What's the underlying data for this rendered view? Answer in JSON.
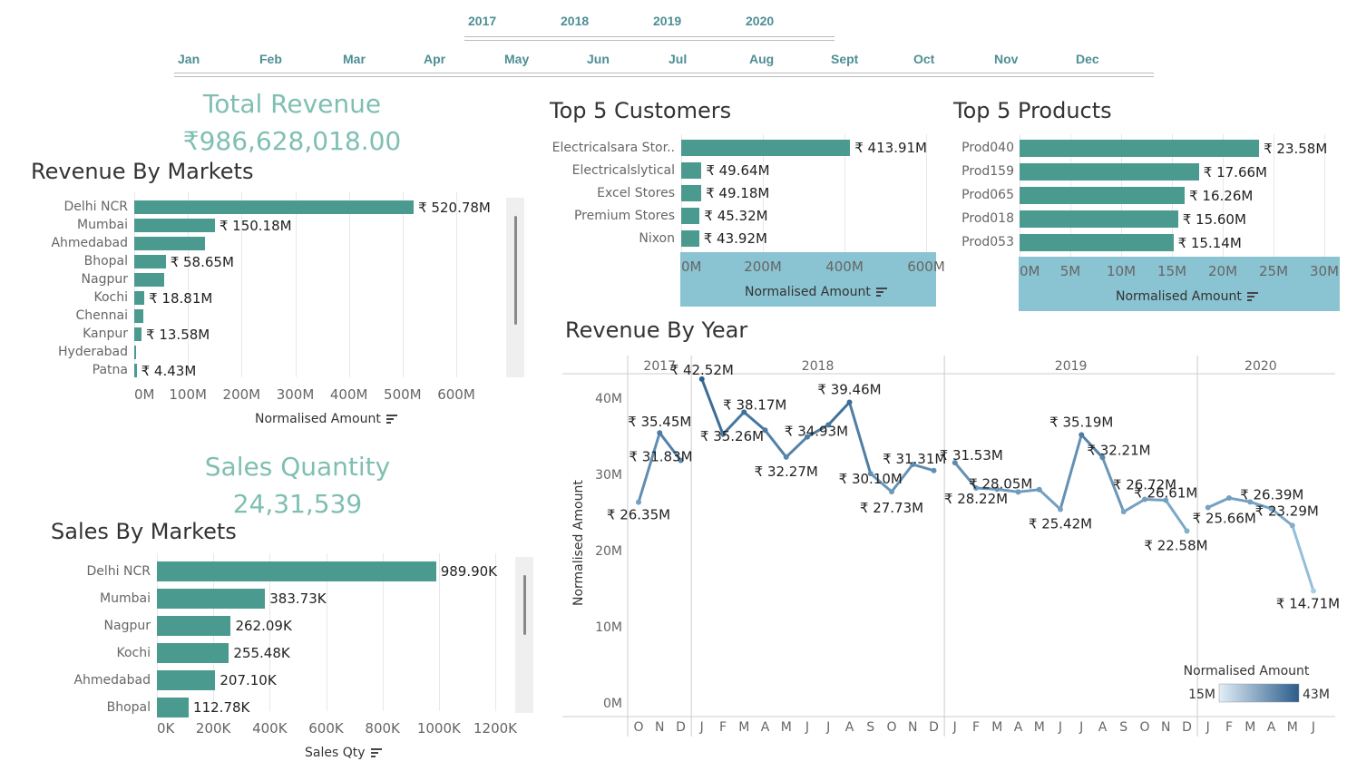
{
  "filters": {
    "years": [
      "2017",
      "2018",
      "2019",
      "2020"
    ],
    "months": [
      "Jan",
      "Feb",
      "Mar",
      "Apr",
      "May",
      "Jun",
      "Jul",
      "Aug",
      "Sept",
      "Oct",
      "Nov",
      "Dec"
    ]
  },
  "kpis": {
    "total_revenue_title": "Total Revenue",
    "total_revenue_value": "₹986,628,018.00",
    "sales_quantity_title": "Sales Quantity",
    "sales_quantity_value": "24,31,539"
  },
  "colors": {
    "bar": "#4a9a90",
    "kpi": "#7fbfb2",
    "filter": "#4e8e95",
    "axis_band": "#8ac3d1",
    "line_low": "#a6cfe6",
    "line_high": "#2b5c8a"
  },
  "chart_data": [
    {
      "id": "revenue_by_markets",
      "type": "bar",
      "title": "Revenue By Markets",
      "categories": [
        "Delhi NCR",
        "Mumbai",
        "Ahmedabad",
        "Bhopal",
        "Nagpur",
        "Kochi",
        "Chennai",
        "Kanpur",
        "Hyderabad",
        "Patna"
      ],
      "values": [
        520.78,
        150.18,
        132,
        58.65,
        55,
        18.81,
        17,
        13.58,
        4,
        4.43
      ],
      "labels": [
        "₹ 520.78M",
        "₹ 150.18M",
        "",
        "₹ 58.65M",
        "",
        "₹ 18.81M",
        "",
        "₹ 13.58M",
        "",
        "₹ 4.43M"
      ],
      "xticks": [
        "0M",
        "100M",
        "200M",
        "300M",
        "400M",
        "500M",
        "600M"
      ],
      "xlim": [
        0,
        600
      ],
      "xlabel": "Normalised Amount"
    },
    {
      "id": "sales_by_markets",
      "type": "bar",
      "title": "Sales By Markets",
      "categories": [
        "Delhi NCR",
        "Mumbai",
        "Nagpur",
        "Kochi",
        "Ahmedabad",
        "Bhopal"
      ],
      "values": [
        989.9,
        383.73,
        262.09,
        255.48,
        207.1,
        112.78
      ],
      "labels": [
        "989.90K",
        "383.73K",
        "262.09K",
        "255.48K",
        "207.10K",
        "112.78K"
      ],
      "xticks": [
        "0K",
        "200K",
        "400K",
        "600K",
        "800K",
        "1000K",
        "1200K"
      ],
      "xlim": [
        0,
        1200
      ],
      "xlabel": "Sales Qty"
    },
    {
      "id": "top5_customers",
      "type": "bar",
      "title": "Top 5 Customers",
      "categories": [
        "Electricalsara Stor..",
        "Electricalslytical",
        "Excel Stores",
        "Premium Stores",
        "Nixon"
      ],
      "values": [
        413.91,
        49.64,
        49.18,
        45.32,
        43.92
      ],
      "labels": [
        "₹ 413.91M",
        "₹ 49.64M",
        "₹ 49.18M",
        "₹ 45.32M",
        "₹ 43.92M"
      ],
      "xticks": [
        "0M",
        "200M",
        "400M",
        "600M"
      ],
      "xlim": [
        0,
        600
      ],
      "xlabel": "Normalised Amount"
    },
    {
      "id": "top5_products",
      "type": "bar",
      "title": "Top 5 Products",
      "categories": [
        "Prod040",
        "Prod159",
        "Prod065",
        "Prod018",
        "Prod053"
      ],
      "values": [
        23.58,
        17.66,
        16.26,
        15.6,
        15.14
      ],
      "labels": [
        "₹ 23.58M",
        "₹ 17.66M",
        "₹ 16.26M",
        "₹ 15.60M",
        "₹ 15.14M"
      ],
      "xticks": [
        "0M",
        "5M",
        "10M",
        "15M",
        "20M",
        "25M",
        "30M"
      ],
      "xlim": [
        0,
        30
      ],
      "xlabel": "Normalised Amount"
    },
    {
      "id": "revenue_by_year",
      "type": "line",
      "title": "Revenue By Year",
      "ylabel": "Normalised Amount",
      "ylim": [
        0,
        45
      ],
      "yticks": [
        "0M",
        "10M",
        "20M",
        "30M",
        "40M"
      ],
      "years": [
        {
          "label": "2017",
          "months": [
            "O",
            "N",
            "D"
          ],
          "values": [
            26.35,
            35.45,
            31.83
          ],
          "labels": [
            "₹ 26.35M",
            "₹ 35.45M",
            "₹ 31.83M"
          ]
        },
        {
          "label": "2018",
          "months": [
            "J",
            "F",
            "M",
            "A",
            "M",
            "J",
            "J",
            "A",
            "S",
            "O",
            "N",
            "D"
          ],
          "values": [
            42.52,
            35.26,
            38.17,
            35.8,
            32.27,
            34.93,
            36.5,
            39.46,
            30.1,
            27.73,
            31.31,
            30.5
          ],
          "labels": [
            "₹ 42.52M",
            "₹ 35.26M",
            "₹ 38.17M",
            "",
            "₹ 32.27M",
            "₹ 34.93M",
            "",
            "₹ 39.46M",
            "₹ 30.10M",
            "₹ 27.73M",
            "₹ 31.31M",
            ""
          ]
        },
        {
          "label": "2019",
          "months": [
            "J",
            "F",
            "M",
            "A",
            "M",
            "J",
            "J",
            "A",
            "S",
            "O",
            "N",
            "D"
          ],
          "values": [
            31.53,
            28.22,
            28.05,
            27.7,
            28.0,
            25.42,
            35.19,
            32.21,
            25.1,
            26.72,
            26.61,
            22.58
          ],
          "labels": [
            "₹ 31.53M",
            "₹ 28.22M",
            "₹ 28.05M",
            "",
            "",
            "₹ 25.42M",
            "₹ 35.19M",
            "₹ 32.21M",
            "",
            "₹ 26.72M",
            "₹ 26.61M",
            "₹ 22.58M"
          ]
        },
        {
          "label": "2020",
          "months": [
            "J",
            "F",
            "M",
            "A",
            "M",
            "J"
          ],
          "values": [
            25.66,
            26.9,
            26.39,
            25.5,
            23.29,
            14.71
          ],
          "labels": [
            "₹ 25.66M",
            "",
            "₹ 26.39M",
            "",
            "₹ 23.29M",
            "₹ 14.71M"
          ]
        }
      ],
      "legend": {
        "title": "Normalised Amount",
        "min_label": "15M",
        "max_label": "43M",
        "position": "bottom-right"
      }
    }
  ]
}
